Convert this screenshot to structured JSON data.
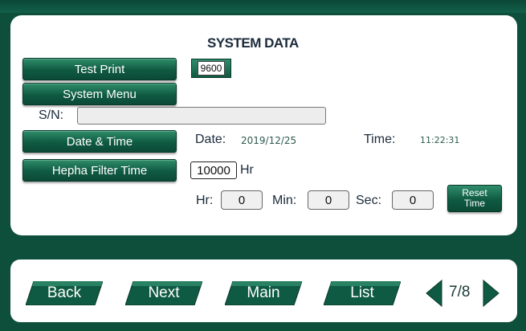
{
  "screen": {
    "title": "SYSTEM DATA"
  },
  "buttons": {
    "test_print": "Test Print",
    "system_menu": "System Menu",
    "date_time": "Date & Time",
    "hepha_filter_time": "Hepha Filter Time",
    "reset_time_line1": "Reset",
    "reset_time_line2": "Time"
  },
  "baud_rate": "9600",
  "serial": {
    "label": "S/N:",
    "value": ""
  },
  "date": {
    "label": "Date:",
    "value": "2019/12/25"
  },
  "time": {
    "label": "Time:",
    "value": "11:22:31"
  },
  "filter": {
    "value": "10000",
    "unit": "Hr"
  },
  "timer": {
    "hr_label": "Hr:",
    "hr_value": "0",
    "min_label": "Min:",
    "min_value": "0",
    "sec_label": "Sec:",
    "sec_value": "0"
  },
  "nav": {
    "back": "Back",
    "next": "Next",
    "main": "Main",
    "list": "List"
  },
  "pager": {
    "text": "7/8"
  },
  "colors": {
    "frame": "#0d4f3b",
    "button_green": "#0f5a42",
    "panel": "#ffffff"
  }
}
